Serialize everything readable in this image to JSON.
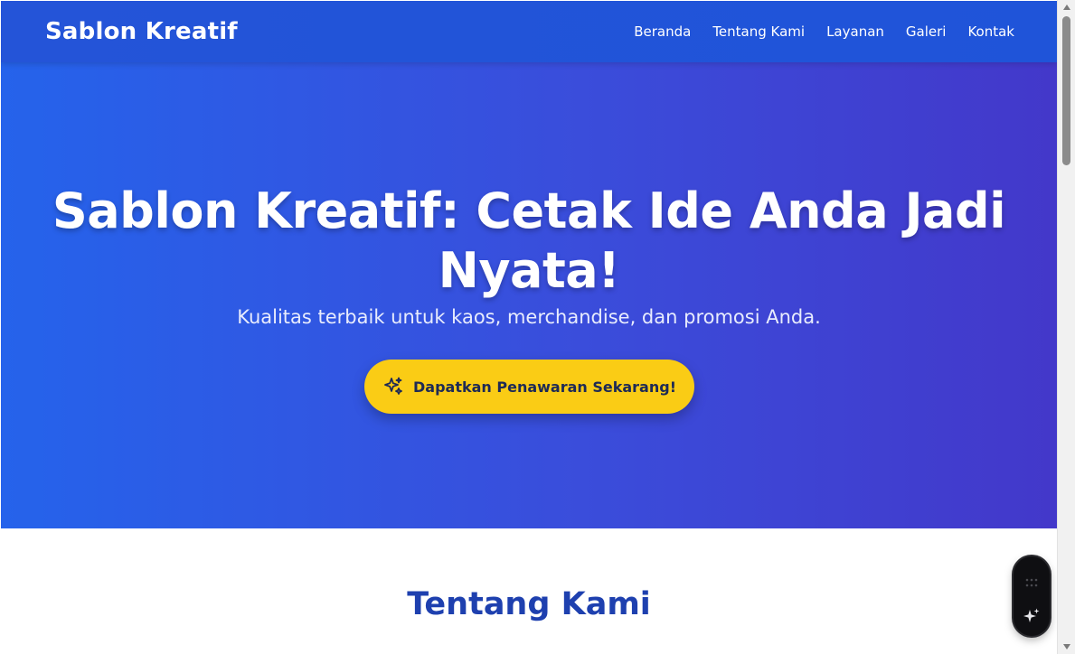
{
  "navbar": {
    "brand": "Sablon Kreatif",
    "links": [
      {
        "label": "Beranda"
      },
      {
        "label": "Tentang Kami"
      },
      {
        "label": "Layanan"
      },
      {
        "label": "Galeri"
      },
      {
        "label": "Kontak"
      }
    ]
  },
  "hero": {
    "title": "Sablon Kreatif: Cetak Ide Anda Jadi Nyata!",
    "subtitle": "Kualitas terbaik untuk kaos, merchandise, dan promosi Anda.",
    "cta_label": "Dapatkan Penawaran Sekarang!",
    "cta_icon": "sparkle-icon"
  },
  "about": {
    "title": "Tentang Kami"
  },
  "floating_widget": {
    "icons": [
      "grip-icon",
      "ai-sparkle-icon"
    ]
  },
  "colors": {
    "nav_bg": "#2454d8",
    "hero_gradient_start": "#2563eb",
    "hero_gradient_end": "#4338ca",
    "cta_bg": "#facc15",
    "cta_text": "#1e2a55",
    "section_title": "#1e40af"
  }
}
